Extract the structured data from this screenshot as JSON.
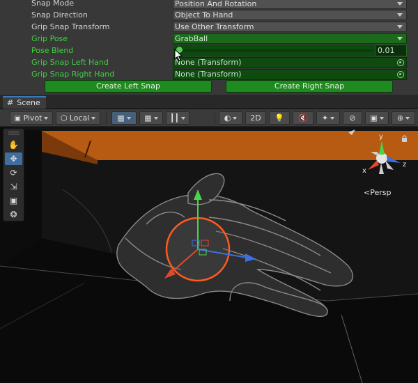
{
  "inspector": {
    "rows": [
      {
        "label": "Snap Mode",
        "value": "Position And Rotation"
      },
      {
        "label": "Snap Direction",
        "value": "Object To Hand"
      },
      {
        "label": "Grip Snap Transform",
        "value": "Use Other Transform"
      },
      {
        "label": "Grip Pose",
        "value": "GrabBall"
      },
      {
        "label": "Pose Blend",
        "value": "0.01"
      },
      {
        "label": "Grip Snap Left Hand",
        "value": "None (Transform)"
      },
      {
        "label": "Grip Snap Right Hand",
        "value": "None (Transform)"
      }
    ],
    "pose_blend_level": 0.01,
    "create_left_snap": "Create Left Snap",
    "create_right_snap": "Create Right Snap"
  },
  "scene": {
    "tab_label": "Scene",
    "toolbar": {
      "pivot": "Pivot",
      "local": "Local",
      "mode_2d": "2D"
    },
    "persp_label": "Persp",
    "gizmo_axes": {
      "y": "y",
      "z": "z",
      "x": "x"
    }
  },
  "colors": {
    "inspector_bg": "#383838",
    "highlight_green": "#1f8a1f",
    "label_green": "#3fd13f",
    "accent_blue": "#3a79bb",
    "wall_orange": "#b75a12",
    "gizmo_ring_orange": "#ff5a1f"
  }
}
